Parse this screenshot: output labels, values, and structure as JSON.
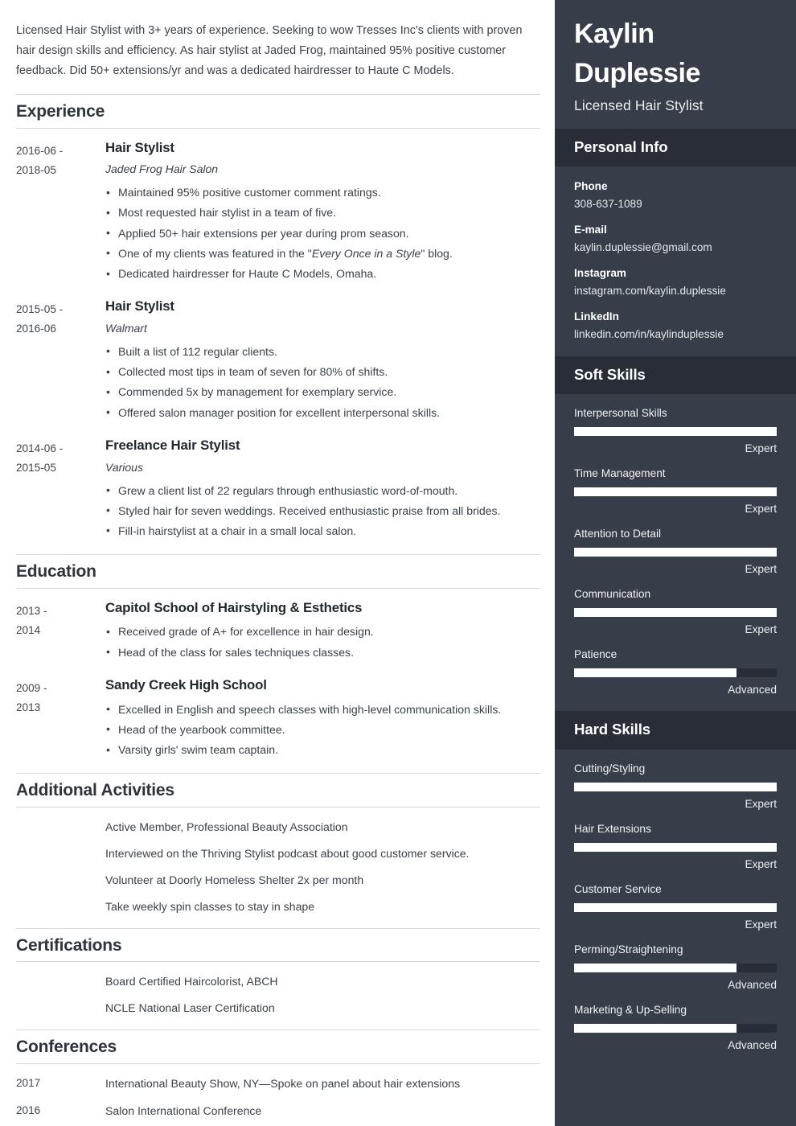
{
  "summary": "Licensed Hair Stylist with 3+ years of experience. Seeking to wow Tresses Inc's clients with proven hair design skills and efficiency. As hair stylist at Jaded Frog, maintained 95% positive customer feedback. Did 50+ extensions/yr and was a dedicated hairdresser to Haute C Models.",
  "sections": {
    "experience_title": "Experience",
    "education_title": "Education",
    "activities_title": "Additional Activities",
    "certifications_title": "Certifications",
    "conferences_title": "Conferences"
  },
  "experience": [
    {
      "date_from": "2016-06 -",
      "date_to": "2018-05",
      "title": "Hair Stylist",
      "org": "Jaded Frog Hair Salon",
      "bullets": [
        "Maintained 95% positive customer comment ratings.",
        "Most requested hair stylist in a team of five.",
        "Applied 50+ hair extensions per year during prom season.",
        "One of my clients was featured in the \"Every Once in a Style\" blog.",
        "Dedicated hairdresser for Haute C Models, Omaha."
      ],
      "italic_in_bullet_index": 3,
      "italic_phrase": "Every Once in a Style"
    },
    {
      "date_from": "2015-05 -",
      "date_to": "2016-06",
      "title": "Hair Stylist",
      "org": "Walmart",
      "bullets": [
        "Built a list of 112 regular clients.",
        "Collected most tips in team of seven for 80% of shifts.",
        "Commended 5x by management for exemplary service.",
        "Offered salon manager position for excellent interpersonal skills."
      ]
    },
    {
      "date_from": "2014-06 -",
      "date_to": "2015-05",
      "title": "Freelance Hair Stylist",
      "org": "Various",
      "bullets": [
        "Grew a client list of 22 regulars through enthusiastic word-of-mouth.",
        "Styled hair for seven weddings. Received enthusiastic praise from all brides.",
        "Fill-in hairstylist at a chair in a small local salon."
      ]
    }
  ],
  "education": [
    {
      "date_from": "2013 -",
      "date_to": "2014",
      "title": "Capitol School of Hairstyling & Esthetics",
      "bullets": [
        "Received grade of A+ for excellence in hair design.",
        "Head of the class for sales techniques classes."
      ]
    },
    {
      "date_from": "2009 -",
      "date_to": "2013",
      "title": "Sandy Creek High School",
      "bullets": [
        "Excelled in English and speech classes with high-level communication skills.",
        "Head of the yearbook committee.",
        "Varsity girls' swim team captain."
      ]
    }
  ],
  "activities": [
    "Active Member, Professional Beauty Association",
    "Interviewed on the Thriving Stylist podcast about good customer service.",
    "Volunteer at Doorly Homeless Shelter 2x per month",
    "Take weekly spin classes to stay in shape"
  ],
  "certifications": [
    "Board Certified Haircolorist, ABCH",
    "NCLE National Laser Certification"
  ],
  "conferences": [
    {
      "year": "2017",
      "text": "International Beauty Show, NY—Spoke on panel about hair extensions"
    },
    {
      "year": "2016",
      "text": "Salon International Conference"
    }
  ],
  "sidebar": {
    "name_line1": "Kaylin",
    "name_line2": "Duplessie",
    "job_title": "Licensed Hair Stylist",
    "personal_info_title": "Personal Info",
    "soft_skills_title": "Soft Skills",
    "hard_skills_title": "Hard Skills",
    "contacts": [
      {
        "label": "Phone",
        "value": "308-637-1089"
      },
      {
        "label": "E-mail",
        "value": "kaylin.duplessie@gmail.com"
      },
      {
        "label": "Instagram",
        "value": "instagram.com/kaylin.duplessie"
      },
      {
        "label": "LinkedIn",
        "value": "linkedin.com/in/kaylinduplessie"
      }
    ],
    "soft_skills": [
      {
        "name": "Interpersonal Skills",
        "level": "Expert",
        "percent": 100
      },
      {
        "name": "Time Management",
        "level": "Expert",
        "percent": 100
      },
      {
        "name": "Attention to Detail",
        "level": "Expert",
        "percent": 100
      },
      {
        "name": "Communication",
        "level": "Expert",
        "percent": 100
      },
      {
        "name": "Patience",
        "level": "Advanced",
        "percent": 80
      }
    ],
    "hard_skills": [
      {
        "name": "Cutting/Styling",
        "level": "Expert",
        "percent": 100
      },
      {
        "name": "Hair Extensions",
        "level": "Expert",
        "percent": 100
      },
      {
        "name": "Customer Service",
        "level": "Expert",
        "percent": 100
      },
      {
        "name": "Perming/Straightening",
        "level": "Advanced",
        "percent": 80
      },
      {
        "name": "Marketing & Up-Selling",
        "level": "Advanced",
        "percent": 80
      }
    ]
  },
  "colors": {
    "sidebar_bg": "#373d49",
    "band_bg": "#282d37",
    "bar_fill": "#ffffff",
    "text_dark": "#3b4049",
    "rule": "#d8d8d8"
  }
}
